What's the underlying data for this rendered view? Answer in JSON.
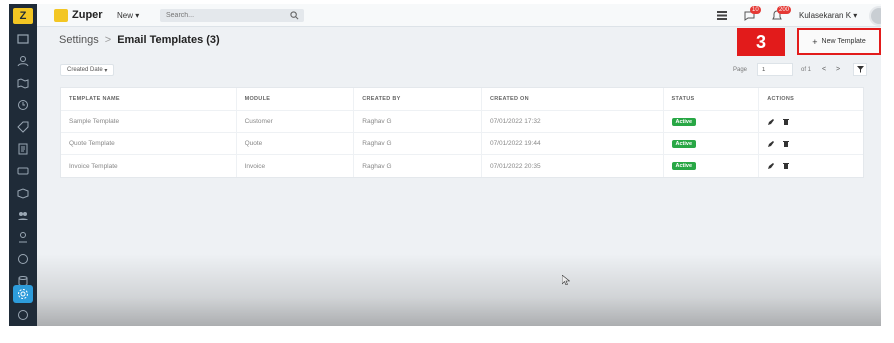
{
  "app": {
    "brand": "Zuper",
    "new_label": "New",
    "search_placeholder": "Search...",
    "notif1_count": "10",
    "notif2_count": "200",
    "user_name": "Kulasekaran K"
  },
  "breadcrumb": {
    "root": "Settings",
    "separator": ">",
    "current": "Email Templates (3)"
  },
  "annotation": {
    "step": "3"
  },
  "toolbar": {
    "new_template": "New Template",
    "filter_label": "Created Date",
    "page_label": "Page",
    "page_value": "1",
    "page_of": "of 1"
  },
  "table": {
    "headers": [
      "TEMPLATE NAME",
      "MODULE",
      "CREATED BY",
      "CREATED ON",
      "STATUS",
      "ACTIONS"
    ],
    "rows": [
      {
        "name": "Sample Template",
        "module": "Customer",
        "created_by": "Raghav G",
        "created_on": "07/01/2022 17:32",
        "status": "Active"
      },
      {
        "name": "Quote Template",
        "module": "Quote",
        "created_by": "Raghav G",
        "created_on": "07/01/2022 19:44",
        "status": "Active"
      },
      {
        "name": "Invoice Template",
        "module": "Invoice",
        "created_by": "Raghav G",
        "created_on": "07/01/2022 20:35",
        "status": "Active"
      }
    ]
  },
  "sidebar": {
    "icons": [
      "dashboard-icon",
      "customers-icon",
      "map-icon",
      "clock-icon",
      "tag-icon",
      "invoice-icon",
      "card-icon",
      "box-icon",
      "team-icon",
      "user-icon",
      "time-icon",
      "database-icon",
      "settings-icon",
      "help-icon"
    ]
  },
  "colors": {
    "accent": "#2d9cdb",
    "status_active": "#28a745",
    "annotation_red": "#e21b1b",
    "sidebar": "#1f2b38"
  }
}
